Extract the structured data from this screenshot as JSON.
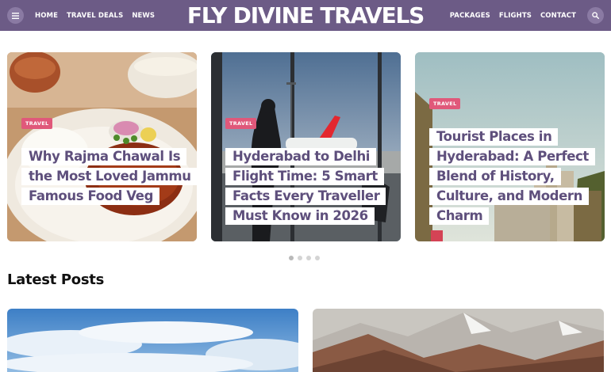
{
  "header": {
    "logo": "FLY DIVINE TRAVELS",
    "menu_icon": "hamburger-menu-icon",
    "search_icon": "search-icon",
    "bg_color": "#6c5b86",
    "nav_left": [
      "HOME",
      "TRAVEL DEALS",
      "NEWS"
    ],
    "nav_right": [
      "PACKAGES",
      "FLIGHTS",
      "CONTACT"
    ]
  },
  "slider": {
    "cards": [
      {
        "category": "TRAVEL",
        "title": "Why Rajma Chawal Is the Most Loved Jammu Famous Food Veg"
      },
      {
        "category": "TRAVEL",
        "title": "Hyderabad to Delhi Flight Time: 5 Smart Facts Every Traveller Must Know in 2026"
      },
      {
        "category": "TRAVEL",
        "title": "Tourist Places in Hyderabad: A Perfect Blend of History, Culture, and Modern Charm"
      }
    ],
    "dots_total": 4,
    "active_dot": 1
  },
  "latest": {
    "heading": "Latest Posts"
  },
  "colors": {
    "badge": "#e0587a",
    "title_text": "#5e4f7c"
  }
}
